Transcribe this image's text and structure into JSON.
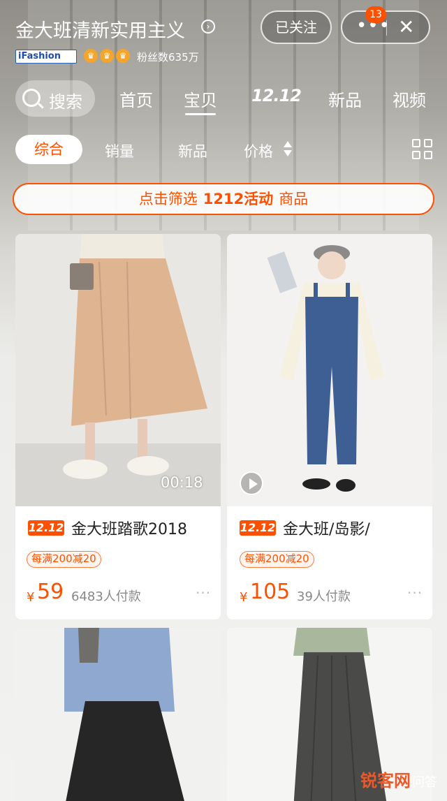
{
  "header": {
    "store_name": "金大班清新实用主义",
    "store_chevron": "›",
    "platform_badge": "iFashion",
    "crowns": [
      "♛",
      "♛",
      "♛"
    ],
    "fans_label": "粉丝数635万",
    "follow_label": "已关注",
    "more_label": "•••",
    "notification_count": "13",
    "close_label": "✕"
  },
  "nav": {
    "search_label": "搜索",
    "tabs": [
      "首页",
      "宝贝",
      "12.12",
      "新品",
      "视频"
    ],
    "active_tab": "宝贝"
  },
  "filters": {
    "items": [
      "综合",
      "销量",
      "新品",
      "价格"
    ],
    "active": "综合"
  },
  "banner": {
    "prefix": "点击筛选",
    "highlight": "1212活动",
    "suffix": "商品"
  },
  "products": [
    {
      "event_tag": "12.12",
      "title": "金大班踏歌2018",
      "promo": "每满200减20",
      "currency": "¥",
      "price": "59",
      "sold": "6483人付款",
      "video_duration": "00:18",
      "more": "···"
    },
    {
      "event_tag": "12.12",
      "title": "金大班/岛影/",
      "promo": "每满200减20",
      "currency": "¥",
      "price": "105",
      "sold": "39人付款",
      "more": "···"
    },
    {},
    {}
  ],
  "watermark": {
    "brand": "锐客网",
    "suffix": "问答"
  },
  "colors": {
    "accent": "#ff5000",
    "tag_bg": "#ff5000",
    "text": "#222222",
    "muted": "#888888"
  }
}
